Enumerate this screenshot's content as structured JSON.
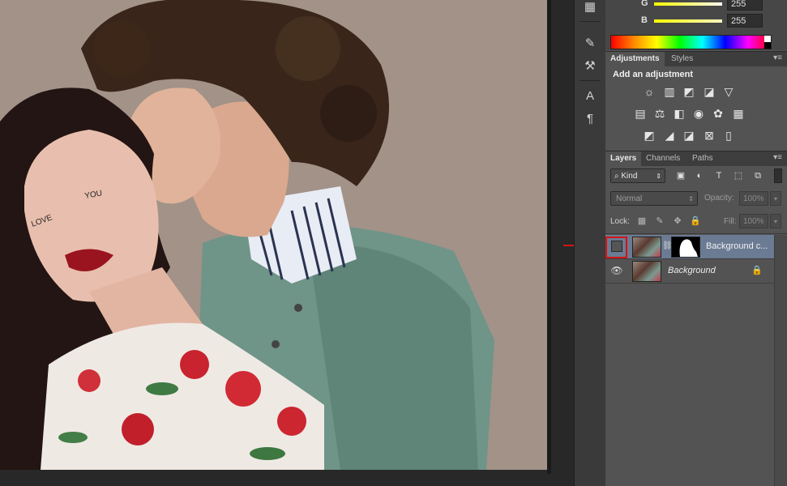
{
  "color_panel": {
    "g_label": "G",
    "g_value": "255",
    "b_label": "B",
    "b_value": "255"
  },
  "adjustments_panel": {
    "tabs": [
      "Adjustments",
      "Styles"
    ],
    "title": "Add an adjustment",
    "row1_icons": [
      "brightness-contrast-icon",
      "levels-icon",
      "curves-icon",
      "exposure-icon",
      "vibrance-icon"
    ],
    "row2_icons": [
      "hue-saturation-icon",
      "color-balance-icon",
      "black-white-icon",
      "photo-filter-icon",
      "channel-mixer-icon",
      "color-lookup-icon"
    ],
    "row3_icons": [
      "invert-icon",
      "posterize-icon",
      "threshold-icon",
      "selective-color-icon",
      "gradient-map-icon"
    ]
  },
  "layers_panel": {
    "tabs": [
      "Layers",
      "Channels",
      "Paths"
    ],
    "kind_label": "Kind",
    "blend_mode": "Normal",
    "opacity_label": "Opacity:",
    "opacity_value": "100%",
    "lock_label": "Lock:",
    "fill_label": "Fill:",
    "fill_value": "100%",
    "layers": [
      {
        "name": "Background c...",
        "visible": false,
        "selected": true,
        "has_mask": true
      },
      {
        "name": "Background",
        "visible": true,
        "selected": false,
        "locked": true
      }
    ]
  },
  "toolstrip": {
    "tools": [
      "3d-icon",
      "brush-presets-icon",
      "tool-presets-icon",
      "character-icon",
      "paragraph-icon"
    ]
  },
  "annotation": {
    "highlight_color": "#d41414"
  }
}
